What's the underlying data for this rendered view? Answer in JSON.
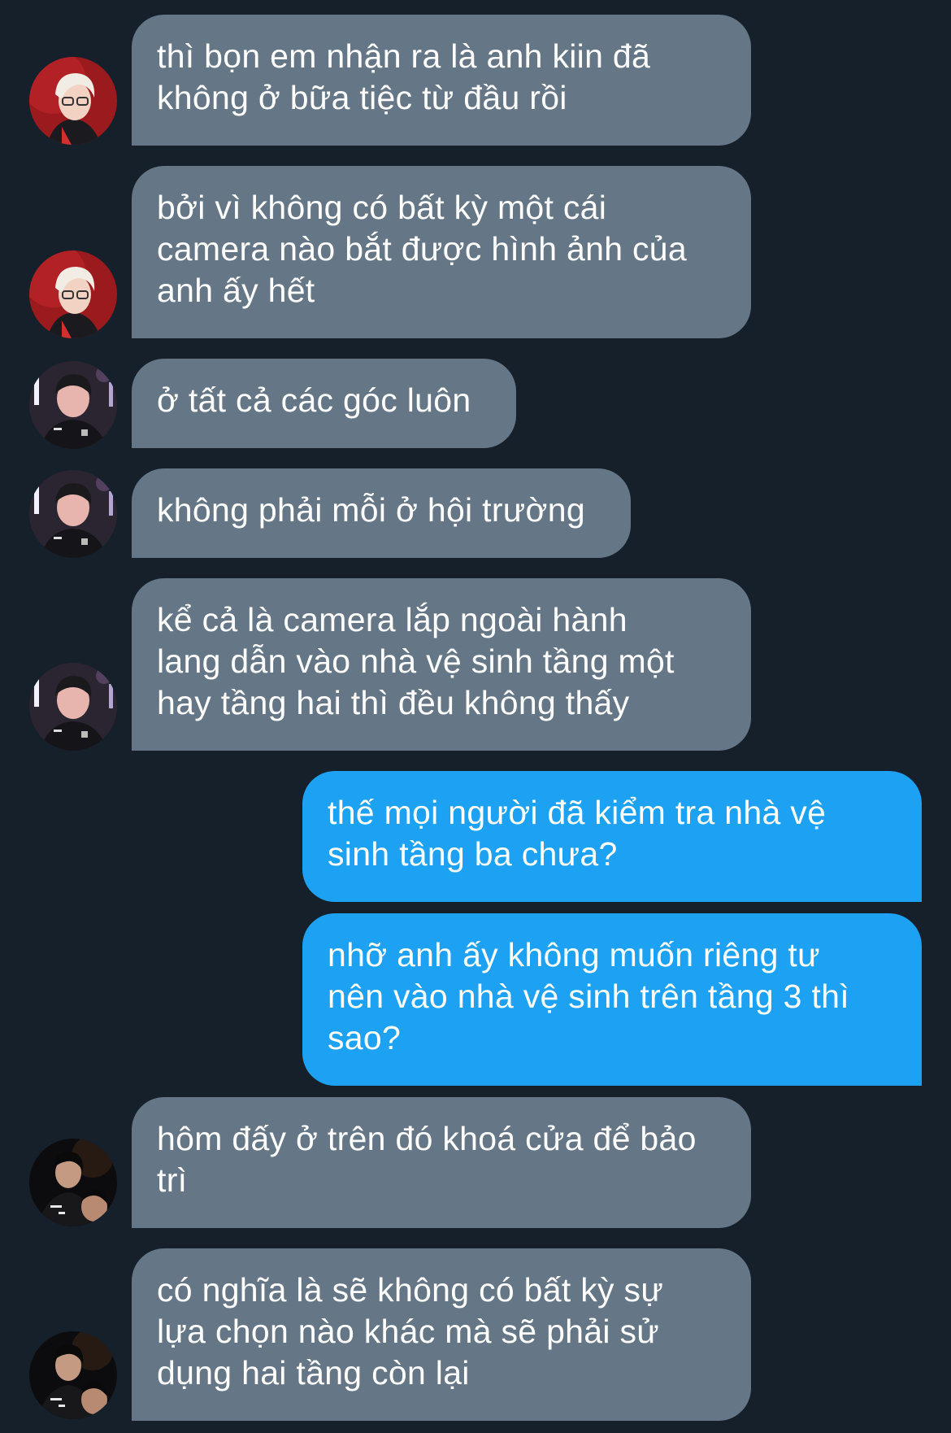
{
  "conversation": {
    "messages": [
      {
        "sender": "incoming",
        "avatar": "avatar-blonde-red",
        "text": "thì bọn em nhận ra là anh kiin đã\nkhông ở bữa tiệc từ đầu rồi"
      },
      {
        "sender": "incoming",
        "avatar": "avatar-blonde-red",
        "text": "bởi vì không có bất kỳ một cái\ncamera nào bắt được hình ảnh của\nanh ấy hết"
      },
      {
        "sender": "incoming",
        "avatar": "avatar-dark-stage",
        "text": "ở tất cả các góc luôn"
      },
      {
        "sender": "incoming",
        "avatar": "avatar-dark-stage",
        "text": "không phải mỗi ở hội trường"
      },
      {
        "sender": "incoming",
        "avatar": "avatar-dark-stage",
        "text": "kể cả là camera lắp ngoài hành\nlang dẫn vào nhà vệ sinh tầng một\nhay tầng hai thì đều không thấy"
      },
      {
        "sender": "outgoing",
        "text": "thế mọi người đã kiểm tra nhà vệ\nsinh tầng ba chưa?"
      },
      {
        "sender": "outgoing",
        "text": "nhỡ anh ấy không muốn riêng tư\nnên vào nhà vệ sinh trên tầng 3 thì\nsao?"
      },
      {
        "sender": "incoming",
        "avatar": "avatar-black-jacket",
        "text": "hôm đấy ở trên đó khoá cửa để bảo\ntrì"
      },
      {
        "sender": "incoming",
        "avatar": "avatar-black-jacket",
        "text": "có nghĩa là sẽ không có bất kỳ sự\nlựa chọn nào khác mà sẽ phải sử\ndụng hai tầng còn lại"
      }
    ]
  },
  "theme": {
    "background": "#15202b",
    "incoming_bubble": "#657786",
    "outgoing_bubble": "#1da1f2",
    "text": "#ffffff"
  }
}
